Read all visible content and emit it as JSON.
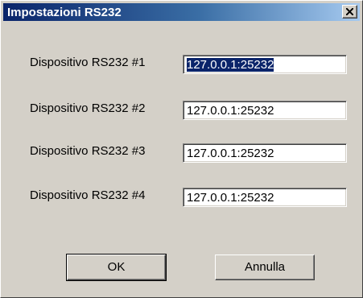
{
  "window": {
    "title": "Impostazioni RS232",
    "close_icon": "close-icon"
  },
  "devices": [
    {
      "label": "Dispositivo RS232 #1",
      "value": "127.0.0.1:25232",
      "selected": true
    },
    {
      "label": "Dispositivo RS232 #2",
      "value": "127.0.0.1:25232",
      "selected": false
    },
    {
      "label": "Dispositivo RS232 #3",
      "value": "127.0.0.1:25232",
      "selected": false
    },
    {
      "label": "Dispositivo RS232 #4",
      "value": "127.0.0.1:25232",
      "selected": false
    }
  ],
  "buttons": {
    "ok_label": "OK",
    "cancel_label": "Annulla"
  },
  "colors": {
    "titlebar_start": "#0a246a",
    "titlebar_end": "#a6caf0",
    "dialog_face": "#d4d0c8",
    "selection": "#0a246a"
  }
}
